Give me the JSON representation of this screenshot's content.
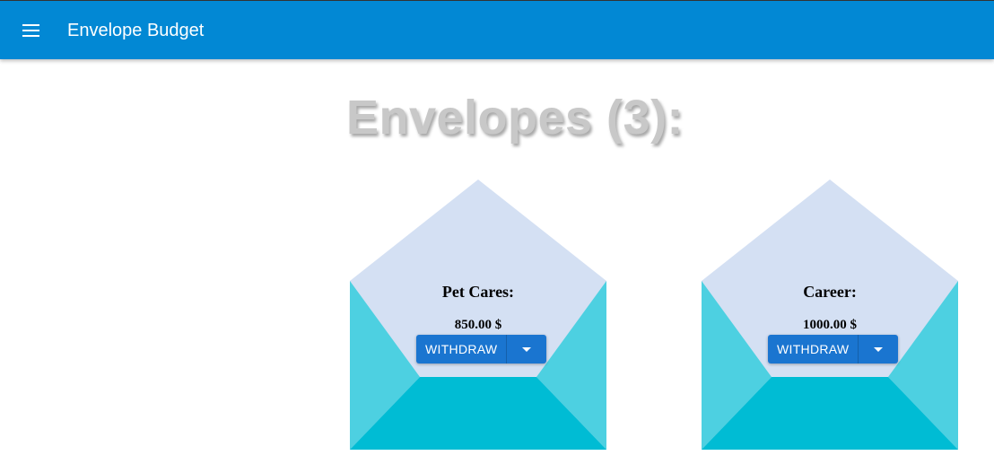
{
  "appbar": {
    "title": "Envelope Budget",
    "menu_icon": "hamburger-menu-icon",
    "color": "#0288d4"
  },
  "heading": "Envelopes (3):",
  "envelopes": [
    {
      "name": "Pet Cares:",
      "amount": "850.00 $",
      "withdraw_label": "WITHDRAW"
    },
    {
      "name": "Career:",
      "amount": "1000.00 $",
      "withdraw_label": "WITHDRAW"
    }
  ],
  "colors": {
    "flap": "#d4e0f3",
    "side": "#4dd0e1",
    "bottom": "#00bcd4",
    "button": "#1a75d0"
  }
}
